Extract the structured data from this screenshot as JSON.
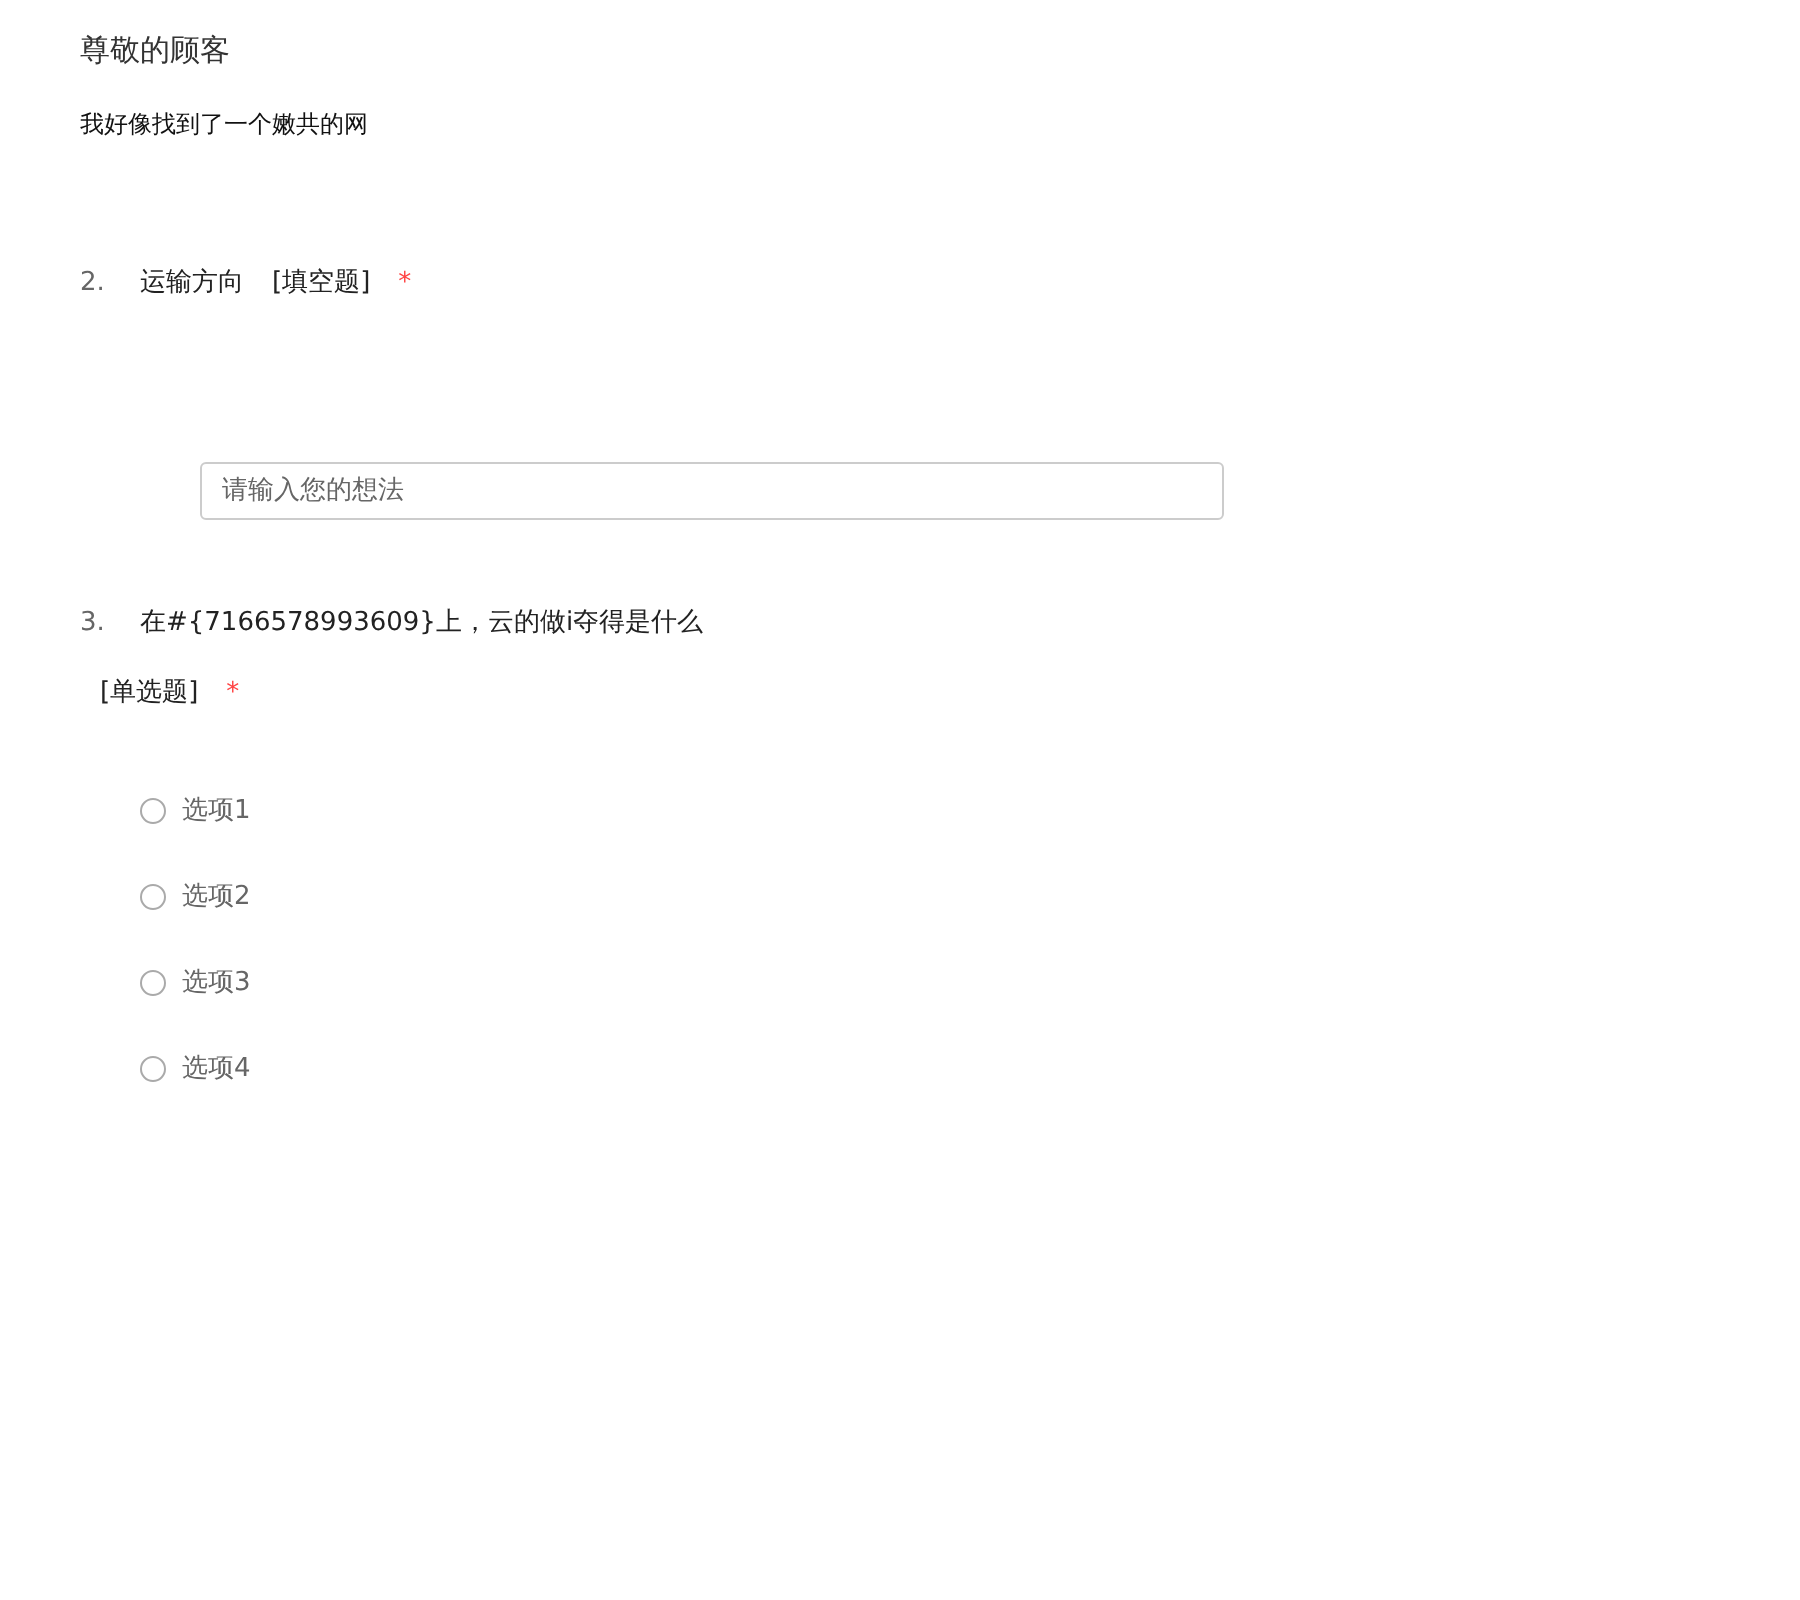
{
  "title": "尊敬的顾客",
  "description": "我好像找到了一个嫩共的网",
  "questions": [
    {
      "kind": "fill",
      "number": "2.",
      "text": "运输方向",
      "type_label": "[填空题]",
      "required_mark": "*",
      "placeholder": "请输入您的想法"
    },
    {
      "kind": "choice",
      "number": "3.",
      "text": "在#{7166578993609}上，云的做i夺得是什么",
      "type_label": "[单选题]",
      "required_mark": "*",
      "options": [
        {
          "label": "选项1",
          "selected": false
        },
        {
          "label": "选项2",
          "selected": false
        },
        {
          "label": "选项3",
          "selected": false
        },
        {
          "label": "选项4",
          "selected": false
        }
      ]
    }
  ]
}
